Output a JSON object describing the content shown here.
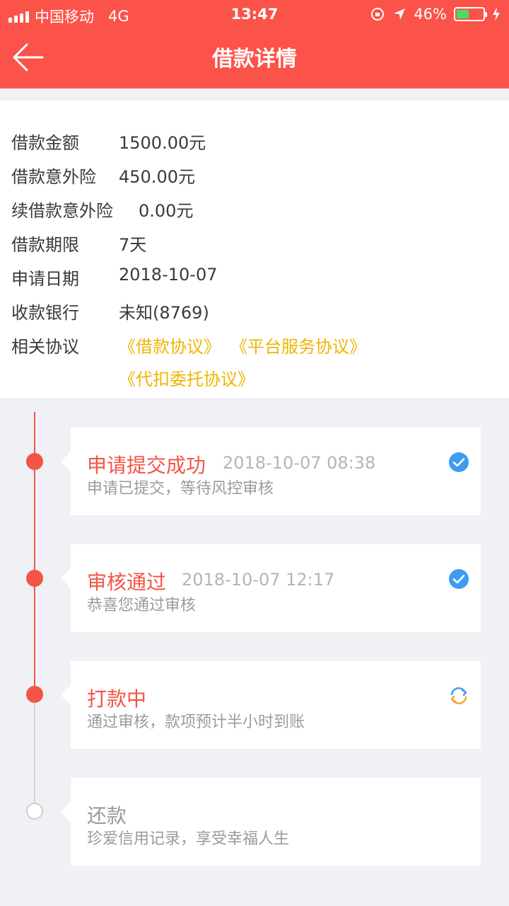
{
  "status_bar": {
    "carrier": "中国移动",
    "network": "4G",
    "time": "13:47",
    "battery": "46%",
    "battery_level": 0.46
  },
  "header": {
    "title": "借款详情"
  },
  "info": {
    "amount_label": "借款金额",
    "amount_value": "1500.00元",
    "insurance_label": "借款意外险",
    "insurance_value": "450.00元",
    "renew_insurance_label": "续借款意外险",
    "renew_insurance_value": "0.00元",
    "term_label": "借款期限",
    "term_value": "7天",
    "date_label": "申请日期",
    "date_value": "2018-10-07",
    "bank_label": "收款银行",
    "bank_value": "未知(8769)",
    "agreements_label": "相关协议",
    "agreements": [
      "《借款协议》",
      "《平台服务协议》",
      "《代扣委托协议》"
    ]
  },
  "timeline": [
    {
      "title": "申请提交成功",
      "time": "2018-10-07 08:38",
      "desc": "申请已提交，等待风控审核",
      "status": "done"
    },
    {
      "title": "审核通过",
      "time": "2018-10-07 12:17",
      "desc": "恭喜您通过审核",
      "status": "done"
    },
    {
      "title": "打款中",
      "time": "",
      "desc": "通过审核，款项预计半小时到账",
      "status": "processing"
    },
    {
      "title": "还款",
      "time": "",
      "desc": "珍爱信用记录，享受幸福人生",
      "status": "pending"
    }
  ],
  "colors": {
    "accent": "#fb5349",
    "link": "#f0b400",
    "check": "#3d9bf0"
  }
}
